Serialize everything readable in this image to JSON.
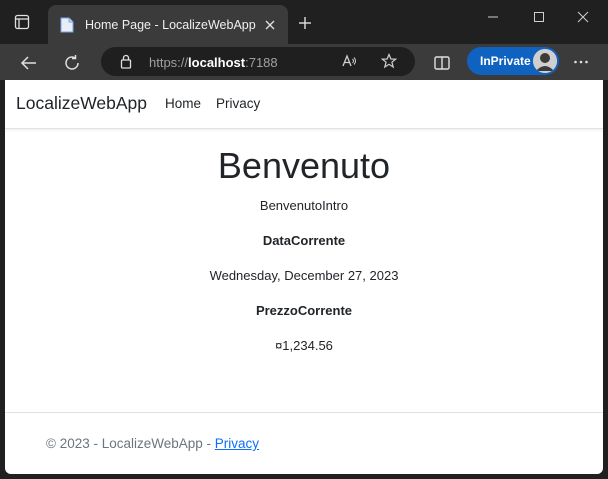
{
  "browser": {
    "tab_title": "Home Page - LocalizeWebApp",
    "url_scheme": "https://",
    "url_host": "localhost",
    "url_port": ":7188",
    "inprivate_label": "InPrivate",
    "icons": [
      "window-menu-icon",
      "page-favicon-icon",
      "close-icon",
      "plus-icon",
      "minimize-icon",
      "maximize-icon",
      "close-window-icon",
      "back-arrow-icon",
      "refresh-icon",
      "lock-icon",
      "read-aloud-icon",
      "favorite-star-icon",
      "split-screen-icon",
      "avatar-icon",
      "more-dots-icon"
    ],
    "accent_color": "#0f62bf"
  },
  "navbar": {
    "brand": "LocalizeWebApp",
    "links": [
      {
        "label": "Home"
      },
      {
        "label": "Privacy"
      }
    ]
  },
  "main": {
    "heading": "Benvenuto",
    "intro": "BenvenutoIntro",
    "date_label": "DataCorrente",
    "date_value": "Wednesday, December 27, 2023",
    "price_label": "PrezzoCorrente",
    "price_value": "¤1,234.56"
  },
  "footer": {
    "text": "© 2023 - LocalizeWebApp - ",
    "link": "Privacy",
    "link_color": "#0d6efd"
  }
}
